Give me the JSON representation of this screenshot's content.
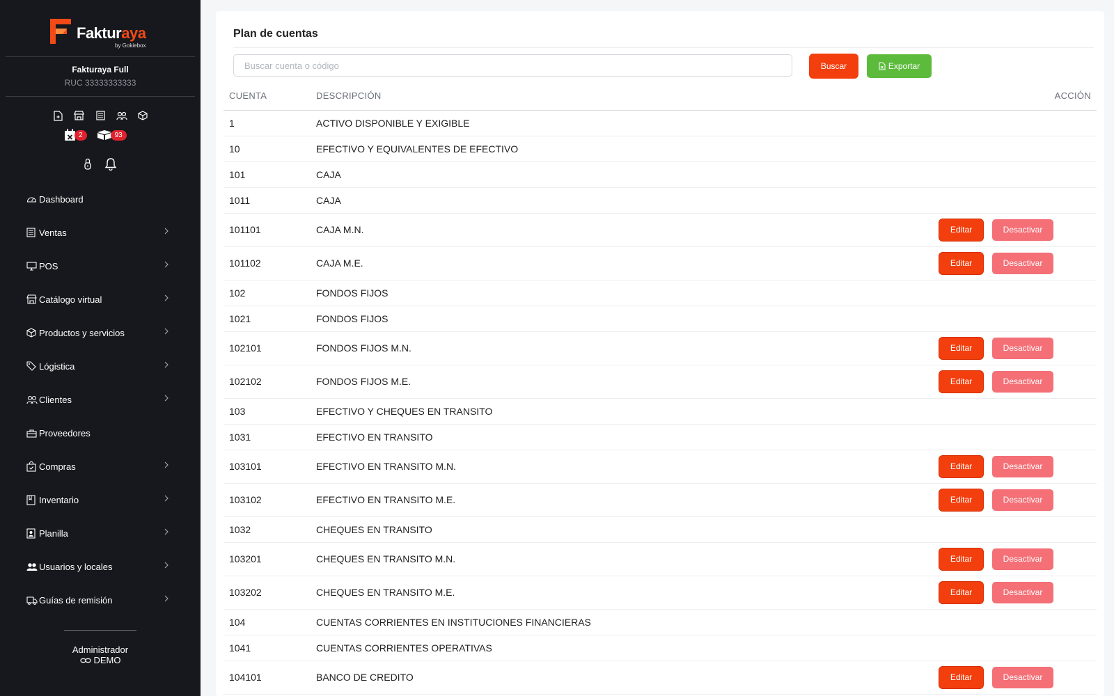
{
  "brand": {
    "name_part1": "Faktur",
    "name_part2": "aya",
    "byline": "by Gokiebox",
    "accent": "#f04a16"
  },
  "sidebar": {
    "company": "Fakturaya Full",
    "ruc": "RUC 33333333333",
    "quick_icons": [
      "new-document-icon",
      "store-icon",
      "receipt-icon",
      "users-icon",
      "box-icon"
    ],
    "badges": [
      {
        "icon": "calendar-x-icon",
        "count": "2"
      },
      {
        "icon": "boxes-icon",
        "count": "93"
      }
    ],
    "tools": [
      "lock-icon",
      "bell-icon"
    ],
    "items": [
      {
        "label": "Dashboard",
        "icon": "speedometer-icon",
        "has_submenu": false
      },
      {
        "label": "Ventas",
        "icon": "receipt-icon",
        "has_submenu": true
      },
      {
        "label": "POS",
        "icon": "monitor-icon",
        "has_submenu": true
      },
      {
        "label": "Catálogo virtual",
        "icon": "store-icon",
        "has_submenu": true
      },
      {
        "label": "Productos y servicios",
        "icon": "box-icon",
        "has_submenu": true
      },
      {
        "label": "Lógistica",
        "icon": "tag-icon",
        "has_submenu": true
      },
      {
        "label": "Clientes",
        "icon": "users-icon",
        "has_submenu": true
      },
      {
        "label": "Proveedores",
        "icon": "briefcase-icon",
        "has_submenu": false
      },
      {
        "label": "Compras",
        "icon": "bag-check-icon",
        "has_submenu": true
      },
      {
        "label": "Inventario",
        "icon": "book-icon",
        "has_submenu": true
      },
      {
        "label": "Planilla",
        "icon": "badge-icon",
        "has_submenu": true
      },
      {
        "label": "Usuarios y locales",
        "icon": "people-fill-icon",
        "has_submenu": true
      },
      {
        "label": "Guías de remisión",
        "icon": "truck-icon",
        "has_submenu": true
      }
    ],
    "user_role": "Administrador",
    "user_name": "DEMO"
  },
  "main": {
    "title": "Plan de cuentas",
    "search_placeholder": "Buscar cuenta o código",
    "search_value": "",
    "buscar_label": "Buscar",
    "exportar_label": "Exportar",
    "table": {
      "headers": {
        "cuenta": "CUENTA",
        "descripcion": "DESCRIPCIÓN",
        "accion": "ACCIÓN"
      },
      "edit_label": "Editar",
      "deactivate_label": "Desactivar",
      "rows": [
        {
          "cuenta": "1",
          "descripcion": "ACTIVO DISPONIBLE Y EXIGIBLE",
          "actions": false
        },
        {
          "cuenta": "10",
          "descripcion": "EFECTIVO Y EQUIVALENTES DE EFECTIVO",
          "actions": false
        },
        {
          "cuenta": "101",
          "descripcion": "CAJA",
          "actions": false
        },
        {
          "cuenta": "1011",
          "descripcion": "CAJA",
          "actions": false
        },
        {
          "cuenta": "101101",
          "descripcion": "CAJA M.N.",
          "actions": true
        },
        {
          "cuenta": "101102",
          "descripcion": "CAJA M.E.",
          "actions": true
        },
        {
          "cuenta": "102",
          "descripcion": "FONDOS FIJOS",
          "actions": false
        },
        {
          "cuenta": "1021",
          "descripcion": "FONDOS FIJOS",
          "actions": false
        },
        {
          "cuenta": "102101",
          "descripcion": "FONDOS FIJOS M.N.",
          "actions": true
        },
        {
          "cuenta": "102102",
          "descripcion": "FONDOS FIJOS M.E.",
          "actions": true
        },
        {
          "cuenta": "103",
          "descripcion": "EFECTIVO Y CHEQUES EN TRANSITO",
          "actions": false
        },
        {
          "cuenta": "1031",
          "descripcion": "EFECTIVO EN TRANSITO",
          "actions": false
        },
        {
          "cuenta": "103101",
          "descripcion": "EFECTIVO EN TRANSITO M.N.",
          "actions": true
        },
        {
          "cuenta": "103102",
          "descripcion": "EFECTIVO EN TRANSITO M.E.",
          "actions": true
        },
        {
          "cuenta": "1032",
          "descripcion": "CHEQUES EN TRANSITO",
          "actions": false
        },
        {
          "cuenta": "103201",
          "descripcion": "CHEQUES EN TRANSITO M.N.",
          "actions": true
        },
        {
          "cuenta": "103202",
          "descripcion": "CHEQUES EN TRANSITO M.E.",
          "actions": true
        },
        {
          "cuenta": "104",
          "descripcion": "CUENTAS CORRIENTES EN INSTITUCIONES FINANCIERAS",
          "actions": false
        },
        {
          "cuenta": "1041",
          "descripcion": "CUENTAS CORRIENTES OPERATIVAS",
          "actions": false
        },
        {
          "cuenta": "104101",
          "descripcion": "BANCO DE CREDITO",
          "actions": true
        }
      ]
    }
  },
  "colors": {
    "sidebar_bg": "#16181d",
    "primary": "#f23f0d",
    "success": "#5dbb3c",
    "danger_light": "#f46f76",
    "badge": "#e0222f"
  }
}
